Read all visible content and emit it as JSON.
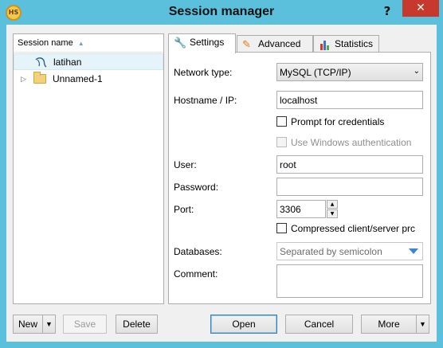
{
  "window": {
    "title": "Session manager",
    "app_icon_text": "HS",
    "help_label": "?",
    "close_label": "✕"
  },
  "tree": {
    "header": "Session name",
    "items": [
      {
        "label": "latihan",
        "icon": "mysql-dolphin-icon",
        "selected": true
      },
      {
        "label": "Unnamed-1",
        "icon": "folder-icon",
        "expander": "▷"
      }
    ]
  },
  "tabs": [
    {
      "label": "Settings",
      "icon": "wrench-icon",
      "active": true
    },
    {
      "label": "Advanced",
      "icon": "tools-icon",
      "active": false
    },
    {
      "label": "Statistics",
      "icon": "bar-chart-icon",
      "active": false
    }
  ],
  "settings": {
    "network_type_label": "Network type:",
    "network_type_value": "MySQL (TCP/IP)",
    "hostname_label": "Hostname / IP:",
    "hostname_value": "localhost",
    "prompt_credentials_label": "Prompt for credentials",
    "windows_auth_label": "Use Windows authentication",
    "user_label": "User:",
    "user_value": "root",
    "password_label": "Password:",
    "password_value": "",
    "port_label": "Port:",
    "port_value": "3306",
    "compressed_label": "Compressed client/server prc",
    "databases_label": "Databases:",
    "databases_placeholder": "Separated by semicolon",
    "comment_label": "Comment:",
    "comment_value": ""
  },
  "buttons": {
    "new": "New",
    "save": "Save",
    "delete": "Delete",
    "open": "Open",
    "cancel": "Cancel",
    "more": "More",
    "dropdown_glyph": "▼"
  },
  "colors": {
    "title_bar": "#5bc0db",
    "close": "#c7392c",
    "selection": "#e5f3fb"
  }
}
